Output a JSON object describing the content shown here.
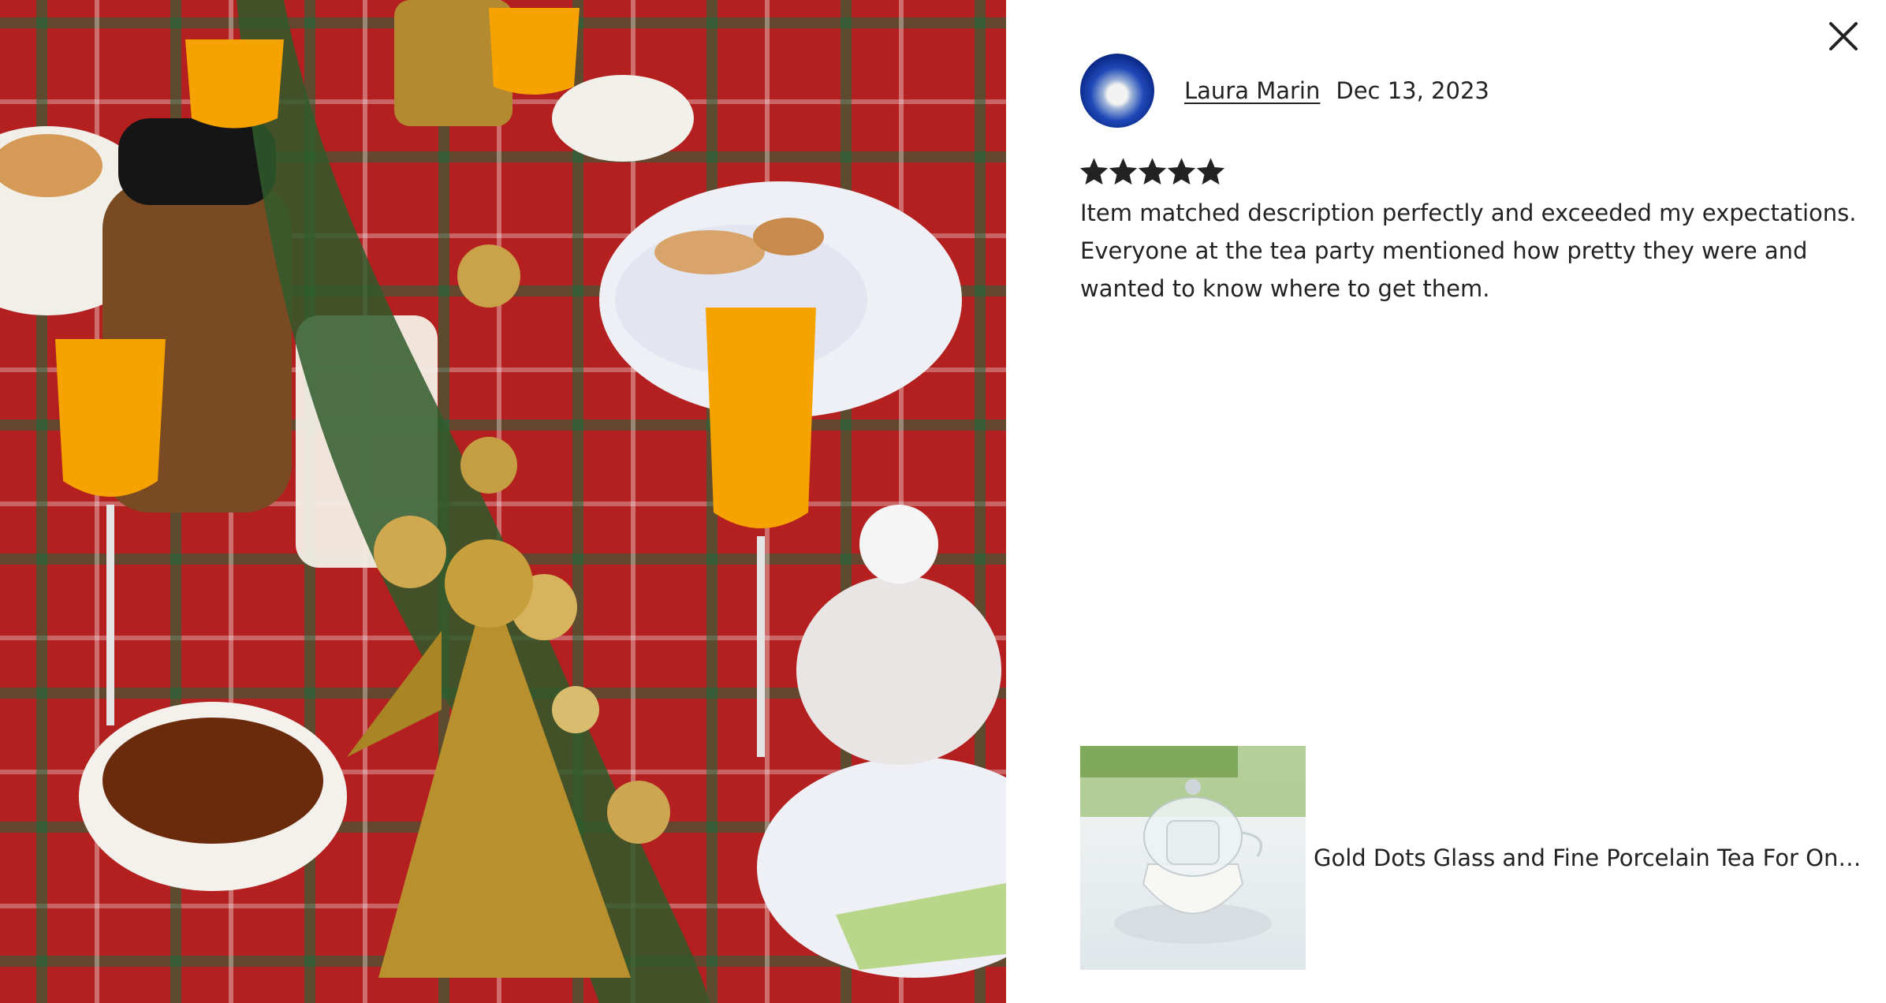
{
  "modal": {
    "close_icon": "close-icon"
  },
  "review": {
    "reviewer_name": "Laura Marin",
    "date": "Dec 13, 2023",
    "rating": 5,
    "rating_max": 5,
    "text": "Item matched description perfectly and exceeded my expectations. Everyone at the tea party mentioned how pretty they were and wanted to know where to get them."
  },
  "product": {
    "title": "Gold Dots Glass and Fine Porcelain Tea For One S..."
  },
  "colors": {
    "text": "#222222",
    "star": "#222222",
    "background": "#ffffff"
  }
}
